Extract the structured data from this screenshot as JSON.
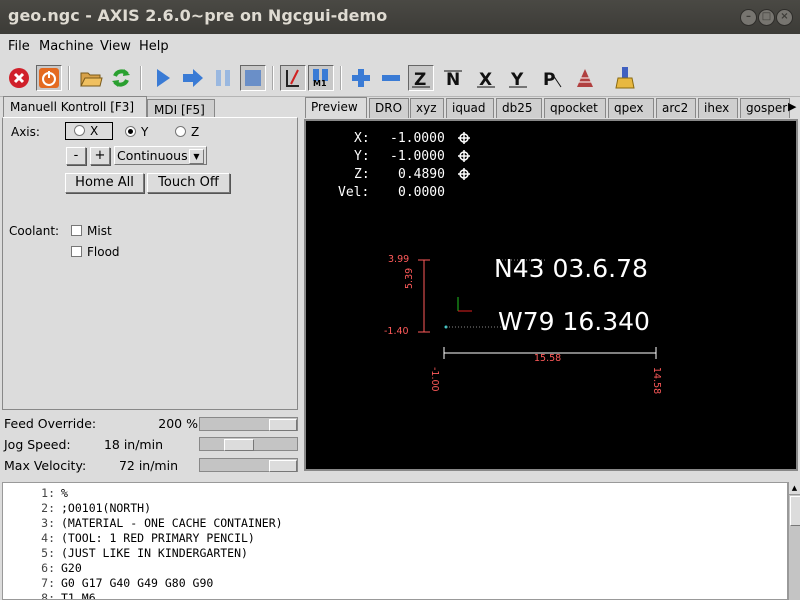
{
  "window": {
    "title": "geo.ngc - AXIS 2.6.0~pre on Ngcgui-demo"
  },
  "menu": [
    {
      "label": "File"
    },
    {
      "label": "Machine"
    },
    {
      "label": "View"
    },
    {
      "label": "Help"
    }
  ],
  "toolbar": {
    "icons": [
      "estop-icon",
      "machine-power-icon",
      "open-file-icon",
      "reload-icon",
      "run-icon",
      "step-icon",
      "pause-icon",
      "stop-icon",
      "toggle-block-delete-icon",
      "toggle-optional-stop-icon",
      "zoom-in-icon",
      "zoom-out-icon",
      "view-z-icon",
      "view-z2-icon",
      "view-x-icon",
      "view-y-icon",
      "view-p-icon",
      "rotate-view-icon",
      "clear-backplot-icon"
    ],
    "optional_stop_label": "M1"
  },
  "left_tabs": [
    {
      "label": "Manuell Kontroll [F3]"
    },
    {
      "label": "MDI [F5]"
    }
  ],
  "manual": {
    "axis_label": "Axis:",
    "axes": [
      {
        "label": "X",
        "selected": false
      },
      {
        "label": "Y",
        "selected": true
      },
      {
        "label": "Z",
        "selected": false
      }
    ],
    "minus_label": "-",
    "plus_label": "+",
    "jog_mode": "Continuous",
    "home_all_label": "Home All",
    "touch_off_label": "Touch Off",
    "coolant_label": "Coolant:",
    "mist_label": "Mist",
    "flood_label": "Flood"
  },
  "sliders": [
    {
      "label": "Feed Override:",
      "value": "200 %",
      "level": 0.95
    },
    {
      "label": "Jog Speed:",
      "value": "18 in/min",
      "level": 0.25
    },
    {
      "label": "Max Velocity:",
      "value": "72 in/min",
      "level": 0.95
    }
  ],
  "right_tabs": [
    "Preview",
    "DRO",
    "xyz",
    "iquad",
    "db25",
    "qpocket",
    "qpex",
    "arc2",
    "ihex",
    "gosper"
  ],
  "dro": {
    "x_label": "X:",
    "x_value": "-1.0000",
    "y_label": "Y:",
    "y_value": "-1.0000",
    "z_label": "Z:",
    "z_value": "0.4890",
    "vel_label": "Vel:",
    "vel_value": "0.0000"
  },
  "plot": {
    "text_north": "N43 03.6.78",
    "text_west": "W79 16.340",
    "dim_top": "3.99",
    "dim_height": "5.39",
    "dim_bottom": "-1.40",
    "dim_width": "15.58",
    "dim_left": "-1.00",
    "dim_right": "14.58",
    "extent_color": "#ff5a5a",
    "path_color": "#ffffff"
  },
  "gcode": [
    {
      "n": "1:",
      "text": "%"
    },
    {
      "n": "2:",
      "text": ";O0101(NORTH)"
    },
    {
      "n": "3:",
      "text": "(MATERIAL - ONE CACHE CONTAINER)"
    },
    {
      "n": "4:",
      "text": "(TOOL: 1 RED PRIMARY PENCIL)"
    },
    {
      "n": "5:",
      "text": "(JUST LIKE IN KINDERGARTEN)"
    },
    {
      "n": "6:",
      "text": "G20"
    },
    {
      "n": "7:",
      "text": "G0 G17 G40 G49 G80 G90"
    },
    {
      "n": "8:",
      "text": "T1 M6"
    }
  ]
}
